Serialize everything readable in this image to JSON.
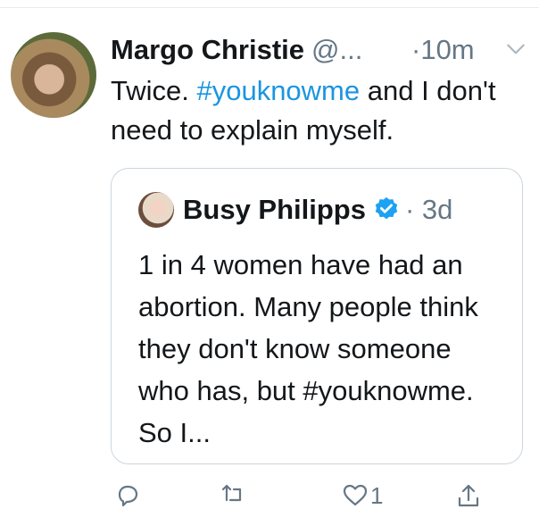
{
  "tweet": {
    "author_name": "Margo Christie",
    "author_handle": "@...",
    "time": "·10m",
    "text_before": "Twice. ",
    "hashtag": "#youknowme",
    "text_after": " and I don't need to explain myself."
  },
  "quoted_tweet": {
    "author_name": "Busy Philipps",
    "time": "· 3d",
    "text": "1 in 4 women have had an abortion. Many people think they don't know someone who has, but #youknowme. So I..."
  },
  "actions": {
    "like_count": "1"
  },
  "colors": {
    "text": "#14171a",
    "secondary": "#657786",
    "link": "#1b95e0",
    "verified": "#1da1f2",
    "border": "#ccd6dd"
  },
  "icons": [
    "chevron-down-icon",
    "verified-badge-icon",
    "reply-icon",
    "retweet-icon",
    "like-icon",
    "share-icon"
  ]
}
